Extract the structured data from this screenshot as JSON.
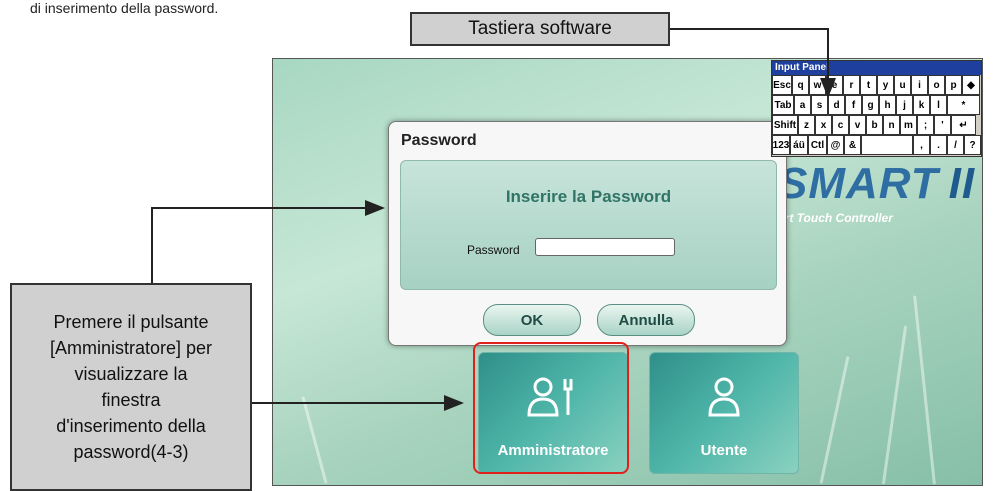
{
  "top_caption": "di inserimento della password.",
  "callouts": {
    "keyboard_label": "Tastiera software",
    "admin_instruction_lines": [
      "Premere il pulsante",
      "[Amministratore] per",
      "visualizzare la",
      "finestra",
      "d'inserimento della",
      "password(4-3)"
    ]
  },
  "logo": {
    "main": "SMART",
    "numeral": "II",
    "tagline": "art Touch Controller"
  },
  "dialog": {
    "title": "Password",
    "heading": "Inserire la Password",
    "password_label": "Password",
    "password_value": "",
    "ok_label": "OK",
    "cancel_label": "Annulla"
  },
  "tiles": {
    "admin_label": "Amministratore",
    "user_label": "Utente"
  },
  "keyboard": {
    "title": "Input Panel",
    "rows": [
      [
        "Esc",
        "q",
        "w",
        "e",
        "r",
        "t",
        "y",
        "u",
        "i",
        "o",
        "p",
        "◆"
      ],
      [
        "Tab",
        "a",
        "s",
        "d",
        "f",
        "g",
        "h",
        "j",
        "k",
        "l",
        "*"
      ],
      [
        "Shift",
        "z",
        "x",
        "c",
        "v",
        "b",
        "n",
        "m",
        ";",
        "'",
        "↵"
      ],
      [
        "123",
        "áü",
        "Ctl",
        "@",
        "&",
        "",
        ",",
        ".",
        "/",
        "?"
      ]
    ]
  },
  "colors": {
    "highlight": "#e0201b",
    "logo": "#2f6ea3",
    "dialog_heading": "#2f7466"
  }
}
